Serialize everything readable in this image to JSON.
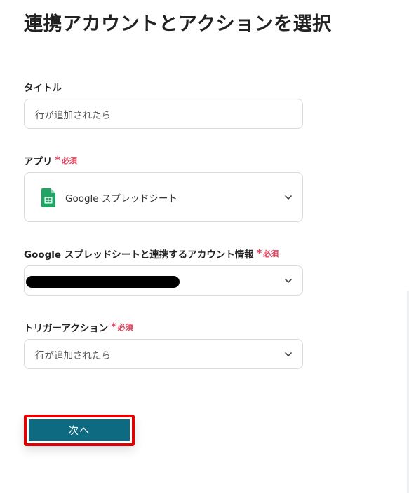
{
  "page": {
    "title": "連携アカウントとアクションを選択"
  },
  "fields": {
    "title": {
      "label": "タイトル",
      "value": "行が追加されたら"
    },
    "app": {
      "label": "アプリ",
      "required": "必須",
      "value": "Google スプレッドシート",
      "icon": "google-sheets-icon",
      "icon_color": "#1fa463"
    },
    "account": {
      "label": "Google スプレッドシートと連携するアカウント情報",
      "required": "必須"
    },
    "trigger": {
      "label": "トリガーアクション",
      "required": "必須",
      "value": "行が追加されたら"
    }
  },
  "actions": {
    "next_label": "次へ",
    "next_color": "#0d6a80",
    "highlight_color": "#e30000"
  },
  "colors": {
    "required": "#e0405a"
  }
}
